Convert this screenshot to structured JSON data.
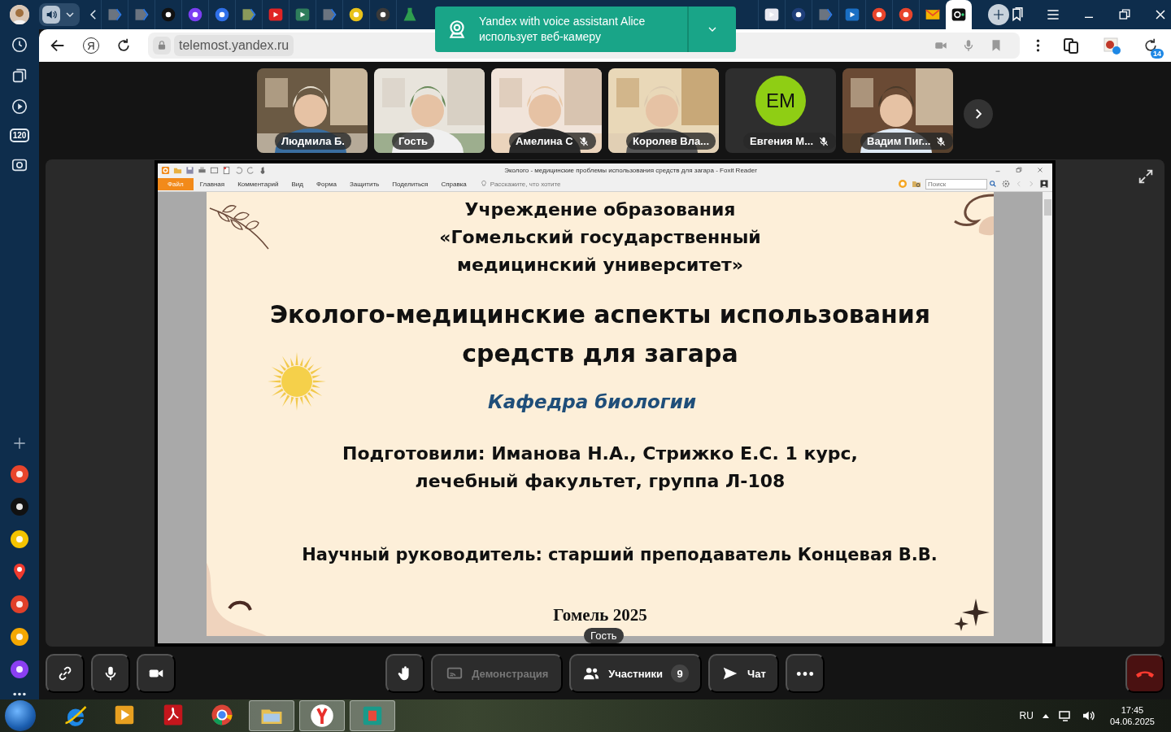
{
  "browser": {
    "tabs": [
      {
        "kind": "audio",
        "selected": false
      },
      {
        "kind": "tag",
        "color": "#6b7480",
        "selected": false
      },
      {
        "kind": "tag",
        "color": "#6b7480",
        "selected": false
      },
      {
        "kind": "circle",
        "color": "#111111",
        "selected": false
      },
      {
        "kind": "circle",
        "color": "#7b3ff2",
        "selected": false
      },
      {
        "kind": "circle",
        "color": "#2f6fe8",
        "selected": false
      },
      {
        "kind": "tag",
        "color": "#8a9a5b",
        "selected": false
      },
      {
        "kind": "square",
        "color": "#e02424",
        "selected": false
      },
      {
        "kind": "square",
        "color": "#2e7d5b",
        "selected": false
      },
      {
        "kind": "tag",
        "color": "#6b7480",
        "selected": false
      },
      {
        "kind": "circle",
        "color": "#e8c21a",
        "selected": false
      },
      {
        "kind": "circle",
        "color": "#3a3a3a",
        "selected": false
      },
      {
        "kind": "flask",
        "color": "#2e9e4f",
        "selected": false
      },
      {
        "kind": "square",
        "color": "#e8e8f0",
        "selected": false
      },
      {
        "kind": "circle",
        "color": "#1f3f7a",
        "selected": false
      },
      {
        "kind": "tag",
        "color": "#6b7480",
        "selected": false
      },
      {
        "kind": "square",
        "color": "#1a6fc4",
        "selected": false
      },
      {
        "kind": "circle",
        "color": "#e8452c",
        "selected": false
      },
      {
        "kind": "circle",
        "color": "#e8452c",
        "selected": false
      },
      {
        "kind": "mail",
        "color": "#f5b400",
        "selected": false
      },
      {
        "kind": "camera",
        "color": "#111111",
        "selected": true
      }
    ],
    "address": {
      "home_label": "Я",
      "url": "telemost.yandex.ru",
      "downloads_count": "14"
    },
    "sidebar": {
      "top_items": [
        {
          "kind": "history"
        },
        {
          "kind": "tabs"
        },
        {
          "kind": "play"
        },
        {
          "kind": "badge",
          "label": "120"
        },
        {
          "kind": "screenshot"
        }
      ],
      "bottom_items": [
        {
          "kind": "plus"
        },
        {
          "kind": "app",
          "color": "#e8452c"
        },
        {
          "kind": "app",
          "color": "#111111"
        },
        {
          "kind": "app",
          "color": "#f5c400"
        },
        {
          "kind": "pin",
          "color": "#f03a2e"
        },
        {
          "kind": "app",
          "color": "#e0402a"
        },
        {
          "kind": "app",
          "color": "#f5a800"
        },
        {
          "kind": "app",
          "color": "#8a3ff2"
        },
        {
          "kind": "more"
        }
      ]
    }
  },
  "notification": {
    "line_1": "Yandex with voice assistant Alice",
    "line_2": "использует веб-камеру"
  },
  "participants": [
    {
      "name": "Людмила Б.",
      "muted": false,
      "kind": "video"
    },
    {
      "name": "Гость",
      "muted": false,
      "kind": "video"
    },
    {
      "name": "Амелина С",
      "muted": true,
      "kind": "video"
    },
    {
      "name": "Королев Вла...",
      "muted": false,
      "kind": "video"
    },
    {
      "name": "Евгения М...",
      "muted": true,
      "kind": "avatar",
      "initials": "EM",
      "color": "#8fce14"
    },
    {
      "name": "Вадим Пиг...",
      "muted": true,
      "kind": "video"
    }
  ],
  "viewer": {
    "title": "Эколого - медицинские проблемы использования средств для загара - Foxit Reader",
    "menu": [
      {
        "label": "Файл",
        "selected": true
      },
      {
        "label": "Главная",
        "selected": false
      },
      {
        "label": "Комментарий",
        "selected": false
      },
      {
        "label": "Вид",
        "selected": false
      },
      {
        "label": "Форма",
        "selected": false
      },
      {
        "label": "Защитить",
        "selected": false
      },
      {
        "label": "Поделиться",
        "selected": false
      },
      {
        "label": "Справка",
        "selected": false
      }
    ],
    "tell_me": {
      "placeholder": "Расскажите, что хотите"
    },
    "search": {
      "placeholder": "Поиск"
    }
  },
  "slide": {
    "institution": "Учреждение образования «Гомельский государственный медицинский университет»",
    "title": "Эколого-медицинские аспекты использования средств для загара",
    "department": "Кафедра биологии",
    "authors": "Подготовили: Иманова Н.А., Стрижко Е.С. 1 курс, лечебный факультет, группа Л-108",
    "advisor": "Научный руководитель: старший преподаватель Концевая В.В.",
    "city": "Гомель 2025"
  },
  "speaker": "Гость",
  "controls": {
    "screen_share": {
      "label": "Демонстрация",
      "disabled": true
    },
    "participants": {
      "label": "Участники",
      "count": "9"
    },
    "chat": {
      "label": "Чат"
    }
  },
  "taskbar": {
    "apps": [
      {
        "kind": "ie",
        "active": false
      },
      {
        "kind": "media",
        "active": false
      },
      {
        "kind": "pdf",
        "active": false
      },
      {
        "kind": "chrome",
        "active": false
      },
      {
        "kind": "folder",
        "active": true
      },
      {
        "kind": "yandex",
        "active": true
      },
      {
        "kind": "box",
        "active": true
      }
    ],
    "language": "RU",
    "time": "17:45",
    "date": "04.06.2025"
  }
}
